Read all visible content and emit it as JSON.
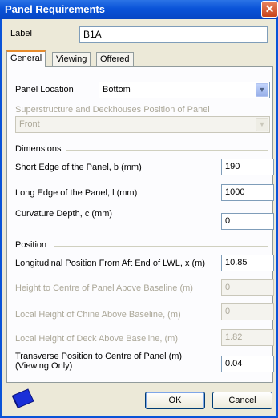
{
  "window": {
    "title": "Panel Requirements"
  },
  "label_field": {
    "label": "Label",
    "value": "B1A"
  },
  "tabs": [
    {
      "label": "General"
    },
    {
      "label": "Viewing"
    },
    {
      "label": "Offered"
    }
  ],
  "general": {
    "panel_location": {
      "label": "Panel Location",
      "value": "Bottom"
    },
    "superstructure": {
      "label": "Superstructure and Deckhouses Position of Panel",
      "value": "Front"
    },
    "dimensions": {
      "heading": "Dimensions",
      "short_edge": {
        "label": "Short Edge of the Panel, b (mm)",
        "value": "190"
      },
      "long_edge": {
        "label": "Long Edge of the Panel, l (mm)",
        "value": "1000"
      },
      "curvature": {
        "label": "Curvature Depth, c (mm)",
        "value": "0"
      }
    },
    "position": {
      "heading": "Position",
      "longitudinal": {
        "label": "Longitudinal Position From Aft End of LWL, x (m)",
        "value": "10.85"
      },
      "height_centre": {
        "label": "Height to Centre of Panel Above Baseline (m)",
        "value": "0"
      },
      "height_chine": {
        "label": "Local Height of Chine Above Baseline, (m)",
        "value": "0"
      },
      "height_deck": {
        "label": "Local Height of Deck Above Baseline, (m)",
        "value": "1.82"
      },
      "transverse": {
        "label_line1": "Transverse Position to Centre of Panel (m)",
        "label_line2": "(Viewing Only)",
        "value": "0.04"
      }
    }
  },
  "buttons": {
    "ok_mnemonic": "O",
    "ok_rest": "K",
    "cancel_mnemonic": "C",
    "cancel_rest": "ancel"
  },
  "colors": {
    "title_bar": "#0a53d8",
    "dialog_bg": "#ece9d8",
    "tab_highlight": "#e68b2c"
  }
}
